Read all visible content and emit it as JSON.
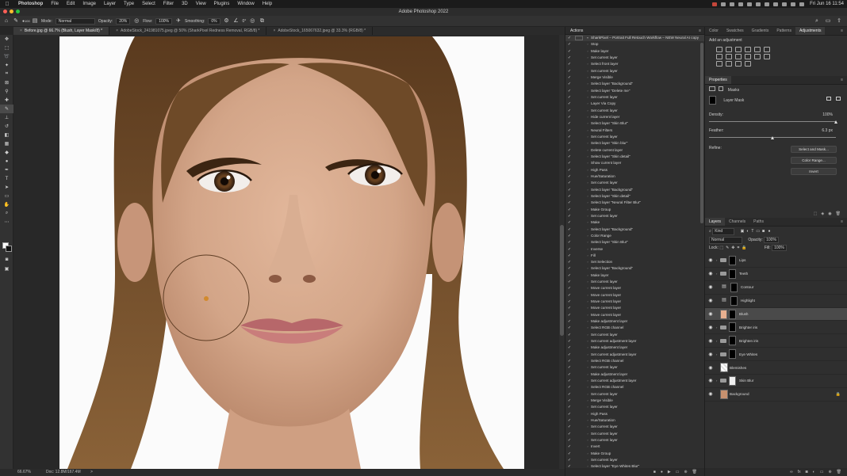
{
  "menubar": {
    "app": "Photoshop",
    "items": [
      "File",
      "Edit",
      "Image",
      "Layer",
      "Type",
      "Select",
      "Filter",
      "3D",
      "View",
      "Plugins",
      "Window",
      "Help"
    ],
    "clock": "Fri Jun 16  11:54"
  },
  "window": {
    "title": "Adobe Photoshop 2022"
  },
  "options": {
    "mode_label": "Mode:",
    "mode_value": "Normal",
    "opacity_label": "Opacity:",
    "opacity_value": "20%",
    "flow_label": "Flow:",
    "flow_value": "100%",
    "smoothing_label": "Smoothing:",
    "smoothing_value": "0%",
    "angle_value": "0°",
    "brush_size": "100"
  },
  "tabs": [
    {
      "label": "Before.jpg @ 66.7% (Blush, Layer Mask/8) *",
      "active": true
    },
    {
      "label": "AdobeStock_241981075.jpeg @ 50% (SharkPixel Redness Removal, RGB/8) *",
      "active": false
    },
    {
      "label": "AdobeStock_165067632.jpeg @ 33.3% (RGB/8) *",
      "active": false
    }
  ],
  "status": {
    "zoom": "66.67%",
    "doc": "Doc: 12.8M/167.4M",
    "arrow": ">"
  },
  "actions": {
    "title": "Actions",
    "set_name": "SharkPixel – Portrait Full Retouch Workflow – NEW Neural AI copy",
    "items": [
      "Stop",
      "Make layer",
      "Set current layer",
      "Select front layer",
      "Set current layer",
      "Merge Visible",
      "Select layer \"Background\"",
      "Select layer \"Delete me\"",
      "Set current layer",
      "Layer Via Copy",
      "Set current layer",
      "Hide current layer",
      "Select layer \"Skin Blur\"",
      "Neural Filters",
      "Set current layer",
      "Select layer \"Skin blur\"",
      "Delete current layer",
      "Select layer \"Skin detail\"",
      "Show current layer",
      "High Pass",
      "Hue/Saturation",
      "Set current layer",
      "Select layer \"Background\"",
      "Select layer \"Skin detail\"",
      "Select layer \"Neural Filter Blur\"",
      "Make Group",
      "Set current layer",
      "Make",
      "Select layer \"Background\"",
      "Color Range",
      "Select layer \"Skin Blur\"",
      "Inverse",
      "Fill",
      "Set Selection",
      "Select layer \"Background\"",
      "Make layer",
      "Set current layer",
      "Move current layer",
      "Move current layer",
      "Move current layer",
      "Move current layer",
      "Move current layer",
      "Make adjustment layer",
      "Select RGB channel",
      "Set current layer",
      "Set current adjustment layer",
      "Make adjustment layer",
      "Set current adjustment layer",
      "Select RGB channel",
      "Set current layer",
      "Make adjustment layer",
      "Set current adjustment layer",
      "Select RGB channel",
      "Set current layer",
      "Merge Visible",
      "Set current layer",
      "High Pass",
      "Hue/Saturation",
      "Set current layer",
      "Set current layer",
      "Set current layer",
      "Invert",
      "Make Group",
      "Set current layer",
      "Select layer \"Eye Whites Blur\"",
      "Move current layer"
    ]
  },
  "adjustments": {
    "tabs": [
      "Color",
      "Swatches",
      "Gradients",
      "Patterns",
      "Adjustments"
    ],
    "add_label": "Add an adjustment"
  },
  "properties": {
    "title": "Properties",
    "masks_label": "Masks",
    "layer_mask_label": "Layer Mask",
    "density_label": "Density:",
    "density_value": "100%",
    "density_fraction": 1.0,
    "feather_label": "Feather:",
    "feather_value": "6.3 px",
    "feather_fraction": 0.5,
    "refine_label": "Refine:",
    "select_mask_btn": "Select and Mask...",
    "color_range_btn": "Color Range...",
    "invert_btn": "Invert"
  },
  "layers_panel": {
    "tabs": [
      "Layers",
      "Channels",
      "Paths"
    ],
    "kind_label": "Kind",
    "blend_mode": "Normal",
    "opacity_label": "Opacity:",
    "opacity_value": "100%",
    "lock_label": "Lock:",
    "fill_label": "Fill:",
    "fill_value": "100%",
    "layers": [
      {
        "name": "Lips",
        "type": "group",
        "selected": false
      },
      {
        "name": "Teeth",
        "type": "group",
        "selected": false
      },
      {
        "name": "Contour",
        "type": "adjust",
        "selected": false
      },
      {
        "name": "Highlight",
        "type": "adjust",
        "selected": false
      },
      {
        "name": "Blush",
        "type": "fill",
        "selected": true
      },
      {
        "name": "Brighter iris",
        "type": "group",
        "selected": false
      },
      {
        "name": "Brighten iris",
        "type": "group",
        "selected": false
      },
      {
        "name": "Eye Whites",
        "type": "group",
        "selected": false
      },
      {
        "name": "Blemishes",
        "type": "pixel",
        "selected": false
      },
      {
        "name": "Skin Blur",
        "type": "group-person",
        "selected": false
      },
      {
        "name": "Background",
        "type": "bg",
        "selected": false
      }
    ]
  },
  "colors": {
    "accent": "#3d8fe0",
    "panel": "#2f2f2f",
    "photo_skin": "#d3a588",
    "hair": "#6b4a2a"
  }
}
